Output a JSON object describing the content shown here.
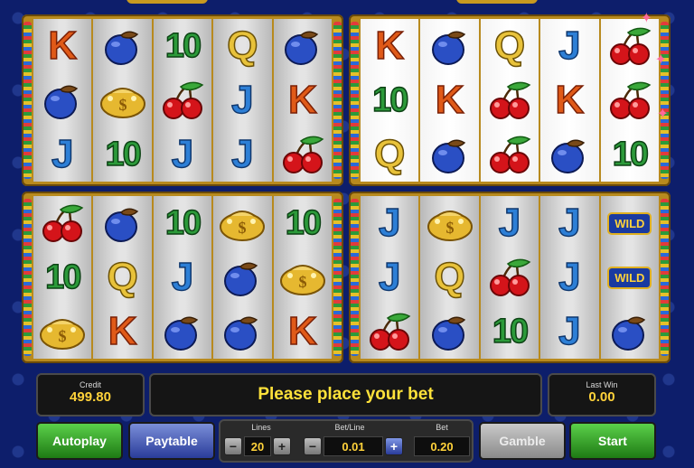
{
  "panels": [
    {
      "reels": [
        [
          "K",
          "plum",
          "J"
        ],
        [
          "plum",
          "gold",
          "10"
        ],
        [
          "10",
          "cherry",
          "J"
        ],
        [
          "Q",
          "J",
          "J"
        ],
        [
          "plum",
          "K",
          "cherry"
        ]
      ]
    },
    {
      "reels": [
        [
          "K",
          "10",
          "Q"
        ],
        [
          "plum",
          "K",
          "plum"
        ],
        [
          "Q",
          "cherry",
          "cherry"
        ],
        [
          "J",
          "K",
          "plum"
        ],
        [
          "cherry",
          "cherry",
          "10"
        ]
      ]
    },
    {
      "reels": [
        [
          "cherry",
          "10",
          "gold"
        ],
        [
          "plum",
          "Q",
          "K"
        ],
        [
          "10",
          "J",
          "plum"
        ],
        [
          "gold",
          "plum",
          "plum"
        ],
        [
          "10",
          "gold",
          "K"
        ]
      ]
    },
    {
      "reels": [
        [
          "J",
          "J",
          "cherry"
        ],
        [
          "gold",
          "Q",
          "plum"
        ],
        [
          "J",
          "cherry",
          "10"
        ],
        [
          "J",
          "J",
          "J"
        ],
        [
          "wild",
          "wild",
          "plum"
        ]
      ]
    }
  ],
  "symbol_labels": {
    "K": "K",
    "J": "J",
    "Q": "Q",
    "10": "10",
    "wild": "WILD"
  },
  "credit": {
    "label": "Credit",
    "value": "499.80"
  },
  "message": "Please place your bet",
  "last_win": {
    "label": "Last Win",
    "value": "0.00"
  },
  "buttons": {
    "autoplay": "Autoplay",
    "paytable": "Paytable",
    "gamble": "Gamble",
    "start": "Start"
  },
  "lines": {
    "label": "Lines",
    "value": "20"
  },
  "bet_line": {
    "label": "Bet/Line",
    "value": "0.01"
  },
  "bet": {
    "label": "Bet",
    "value": "0.20"
  },
  "controls": {
    "minus": "−",
    "plus": "+"
  },
  "colors": {
    "accent": "#ffd23a",
    "background": "#0d1e6b",
    "frame": "#b88a1e"
  }
}
